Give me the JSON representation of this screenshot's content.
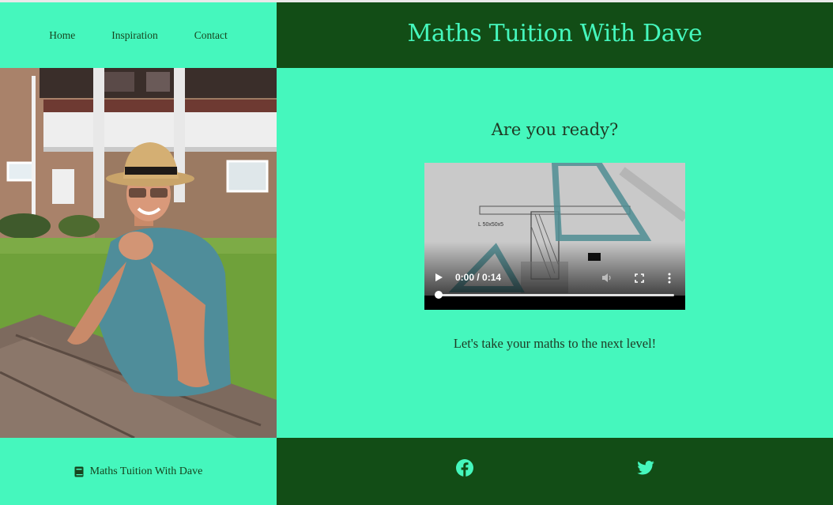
{
  "nav": {
    "items": [
      {
        "label": "Home"
      },
      {
        "label": "Inspiration"
      },
      {
        "label": "Contact"
      }
    ]
  },
  "header": {
    "title": "Maths Tuition With Dave"
  },
  "main": {
    "heading": "Are you ready?",
    "video": {
      "time": "0:00 / 0:14",
      "progress": 0
    },
    "tagline": "Let's take your maths to the next level!"
  },
  "footer": {
    "brand": "Maths Tuition With Dave",
    "brand_icon": "book-icon",
    "social": [
      {
        "icon": "facebook-icon"
      },
      {
        "icon": "twitter-icon"
      }
    ]
  },
  "colors": {
    "mint": "#45f7bd",
    "forest": "#124d16",
    "text": "#1f3a24"
  }
}
